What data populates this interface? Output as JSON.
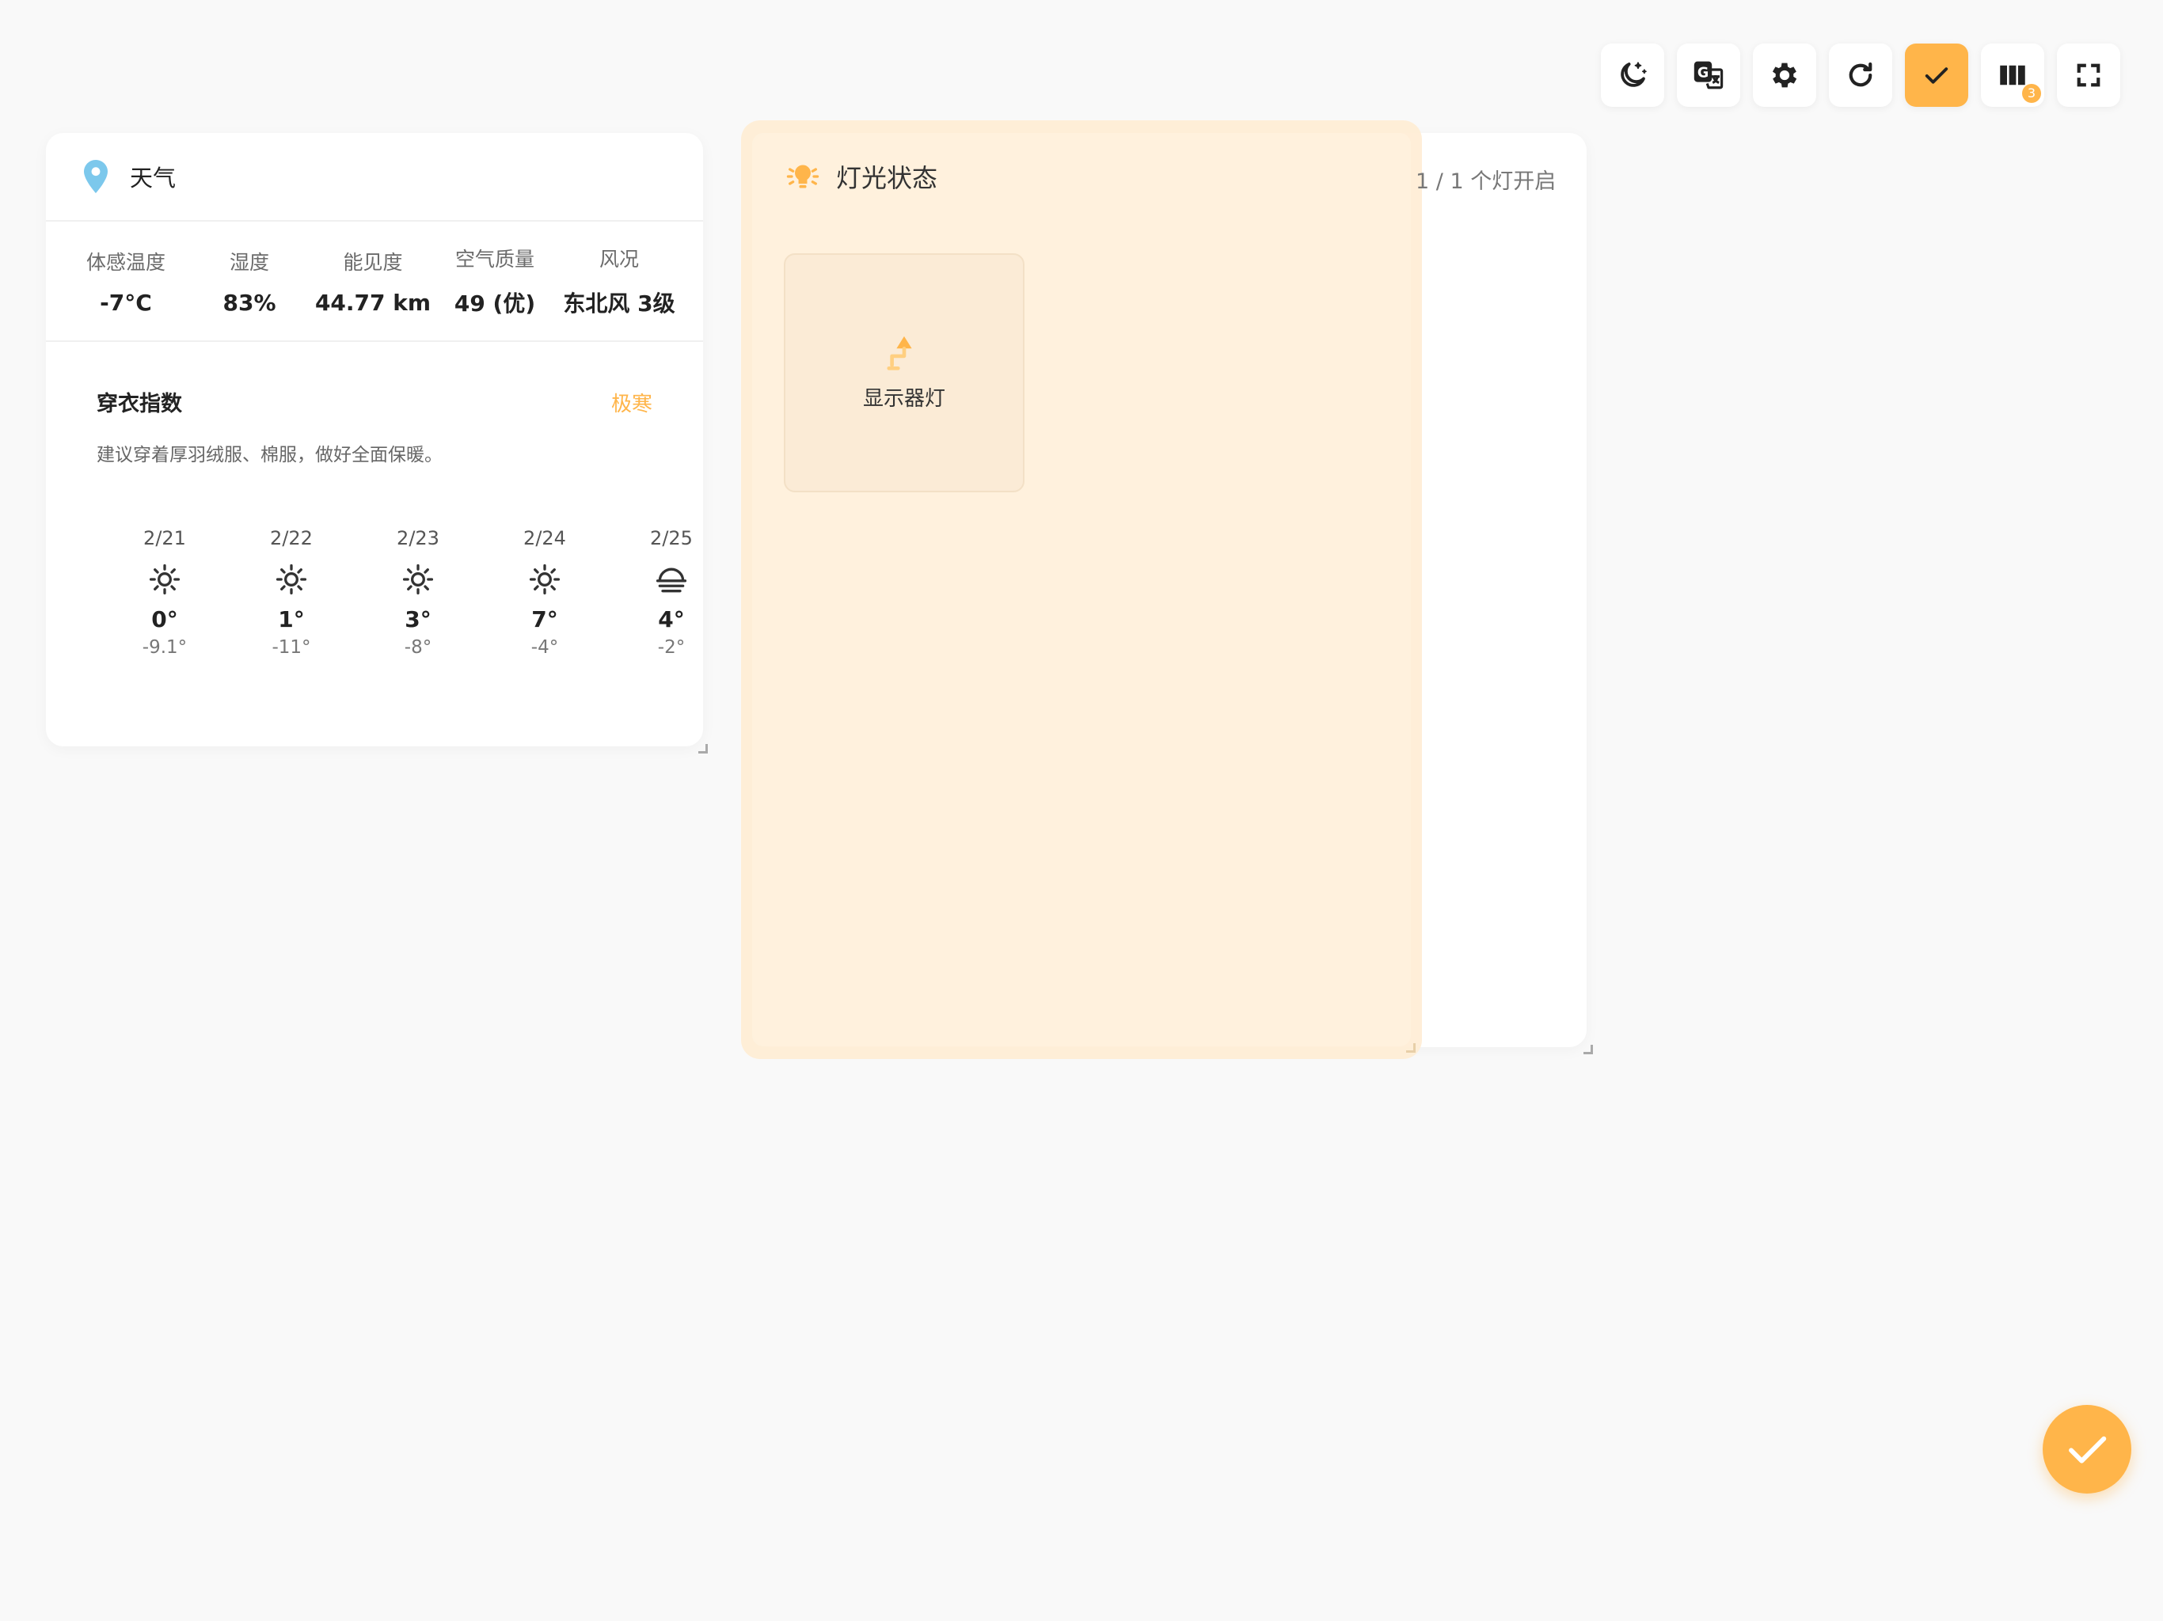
{
  "toolbar": {
    "buttons": [
      {
        "icon": "moon-stars-icon"
      },
      {
        "icon": "translate-icon"
      },
      {
        "icon": "gear-icon"
      },
      {
        "icon": "refresh-icon"
      },
      {
        "icon": "check-icon"
      },
      {
        "icon": "columns-icon",
        "badge": "3"
      },
      {
        "icon": "fullscreen-icon"
      }
    ],
    "accent_color": "#ffb54a"
  },
  "weather": {
    "title": "天气",
    "icon": "location-pin-icon",
    "stats": [
      {
        "label": "体感温度",
        "value": "-7°C"
      },
      {
        "label": "湿度",
        "value": "83%"
      },
      {
        "label": "能见度",
        "value": "44.77 km"
      },
      {
        "label": "空气质量",
        "value": "49 (优)"
      },
      {
        "label": "风况",
        "value": "东北风 3级"
      }
    ],
    "dressing": {
      "title": "穿衣指数",
      "level": "极寒",
      "description": "建议穿着厚羽绒服、棉服，做好全面保暖。"
    },
    "forecast": [
      {
        "date": "2/21",
        "icon": "sunny-icon",
        "high": "0°",
        "low": "-9.1°"
      },
      {
        "date": "2/22",
        "icon": "sunny-icon",
        "high": "1°",
        "low": "-11°"
      },
      {
        "date": "2/23",
        "icon": "sunny-icon",
        "high": "3°",
        "low": "-8°"
      },
      {
        "date": "2/24",
        "icon": "sunny-icon",
        "high": "7°",
        "low": "-4°"
      },
      {
        "date": "2/25",
        "icon": "fog-icon",
        "high": "4°",
        "low": "-2°"
      }
    ]
  },
  "lights": {
    "title": "灯光状态",
    "icon": "lightbulb-icon",
    "count": "1 / 1 个灯开启",
    "devices": [
      {
        "name": "显示器灯",
        "icon": "desk-lamp-icon",
        "on": true
      }
    ]
  },
  "fab": {
    "icon": "check-icon"
  }
}
